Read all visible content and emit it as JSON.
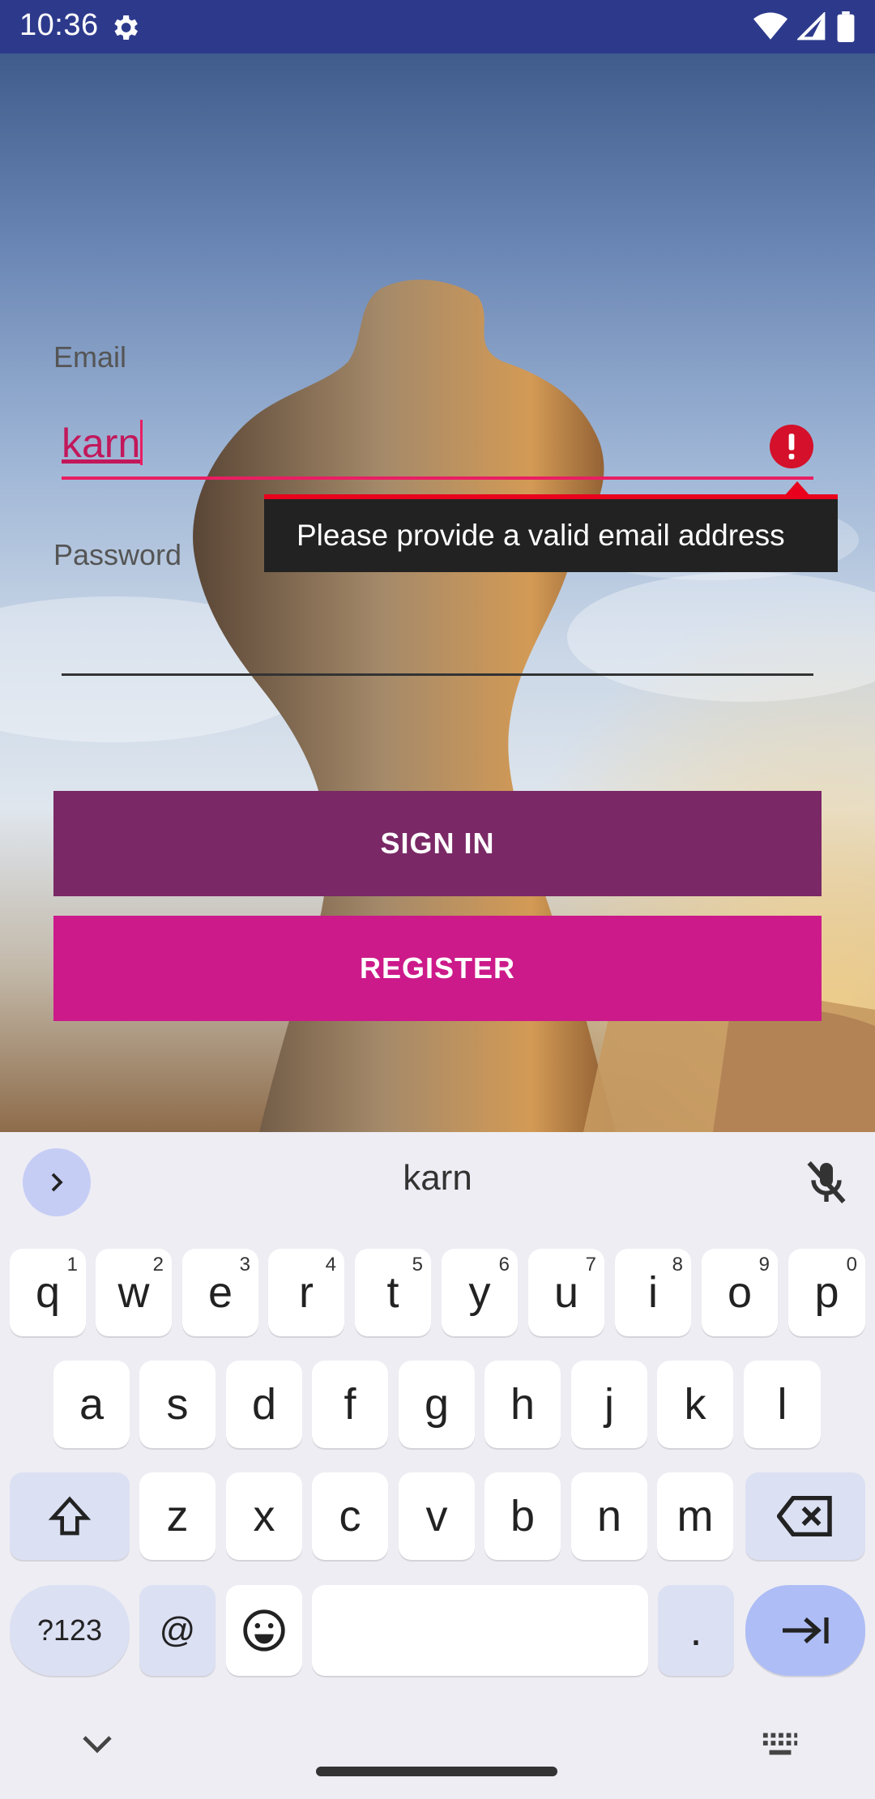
{
  "status_bar": {
    "time": "10:36",
    "icons": [
      "gear-icon",
      "wifi-icon",
      "signal-icon",
      "battery-icon"
    ],
    "background": "#2d3a8c"
  },
  "form": {
    "email_label": "Email",
    "email_value": "karn",
    "error_tooltip": "Please provide a valid email address",
    "password_label": "Password",
    "accent_color": "#e91e63"
  },
  "buttons": {
    "sign_in": "SIGN IN",
    "register": "REGISTER",
    "sign_in_color": "#7a2866",
    "register_color": "#cc1a8a"
  },
  "keyboard": {
    "suggestion": "karn",
    "row1": [
      {
        "key": "q",
        "hint": "1"
      },
      {
        "key": "w",
        "hint": "2"
      },
      {
        "key": "e",
        "hint": "3"
      },
      {
        "key": "r",
        "hint": "4"
      },
      {
        "key": "t",
        "hint": "5"
      },
      {
        "key": "y",
        "hint": "6"
      },
      {
        "key": "u",
        "hint": "7"
      },
      {
        "key": "i",
        "hint": "8"
      },
      {
        "key": "o",
        "hint": "9"
      },
      {
        "key": "p",
        "hint": "0"
      }
    ],
    "row2": [
      "a",
      "s",
      "d",
      "f",
      "g",
      "h",
      "j",
      "k",
      "l"
    ],
    "row3": [
      "z",
      "x",
      "c",
      "v",
      "b",
      "n",
      "m"
    ],
    "symbols_label": "?123",
    "at_label": "@",
    "period_label": "."
  }
}
